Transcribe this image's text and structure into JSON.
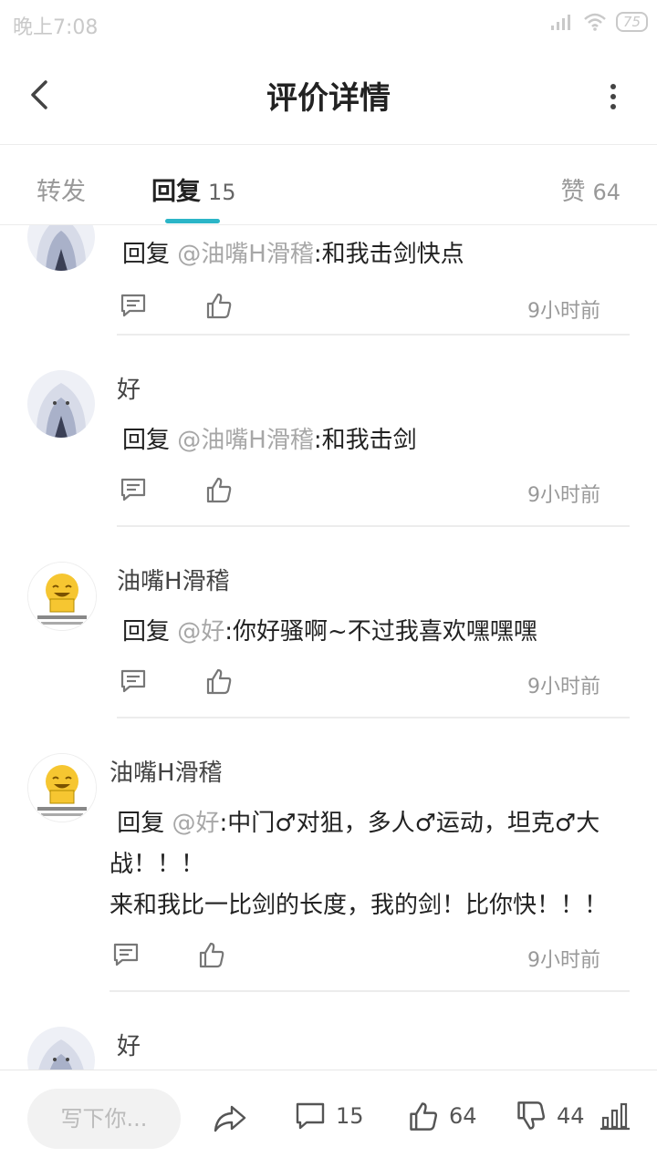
{
  "status": {
    "time": "晚上7:08",
    "battery": "75"
  },
  "header": {
    "title": "评价详情"
  },
  "tabs": {
    "forward_label": "转发",
    "reply_label": "回复",
    "reply_count": "15",
    "like_label": "赞",
    "like_count": "64"
  },
  "replies": [
    {
      "name": "",
      "prefix": "回复 ",
      "mention": "@油嘴H滑稽",
      "text": ":和我击剑快点",
      "time": "9小时前"
    },
    {
      "name": "好",
      "prefix": "回复 ",
      "mention": "@油嘴H滑稽",
      "text": ":和我击剑",
      "time": "9小时前"
    },
    {
      "name": "油嘴H滑稽",
      "prefix": "回复 ",
      "mention": "@好",
      "text": ":你好骚啊~不过我喜欢嘿嘿嘿",
      "time": "9小时前"
    },
    {
      "name": "油嘴H滑稽",
      "prefix": "回复 ",
      "mention": "@好",
      "text": ":中门♂对狙，多人♂运动，坦克♂大",
      "text2": "战！！！",
      "text3": "来和我比一比剑的长度，我的剑！比你快！！！",
      "time": "9小时前"
    },
    {
      "name": "好"
    }
  ],
  "bottombar": {
    "placeholder": "写下你...",
    "comment_count": "15",
    "like_count": "64",
    "dislike_count": "44"
  },
  "colors": {
    "accent": "#2bb5c7",
    "mention": "#a7a7a7",
    "text": "#222222",
    "muted": "#999999"
  }
}
